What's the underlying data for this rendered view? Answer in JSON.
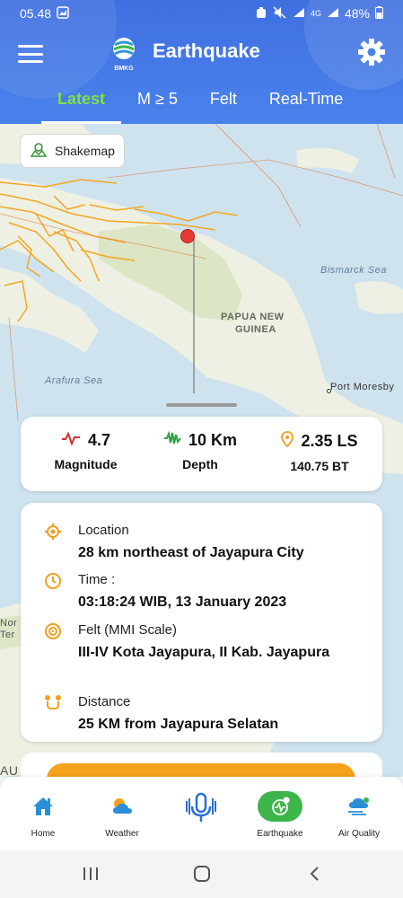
{
  "status": {
    "time": "05.48",
    "network": "4G",
    "battery": "48%"
  },
  "app": {
    "title": "Earthquake",
    "logo_text": "BMKG"
  },
  "tabs": [
    {
      "label": "Latest",
      "active": true
    },
    {
      "label": "M ≥ 5",
      "active": false
    },
    {
      "label": "Felt",
      "active": false
    },
    {
      "label": "Real-Time",
      "active": false
    }
  ],
  "map": {
    "shakemap_label": "Shakemap",
    "labels": {
      "bismarck": "Bismarck Sea",
      "papua": "PAPUA NEW",
      "guinea": "GUINEA",
      "arafura": "Arafura Sea",
      "moresby": "Port Moresby",
      "nor": "Nor",
      "ter": "Ter",
      "au": "AU"
    }
  },
  "summary": {
    "magnitude_value": "4.7",
    "magnitude_label": "Magnitude",
    "depth_value": "10 Km",
    "depth_label": "Depth",
    "lat_value": "2.35 LS",
    "lon_value": "140.75 BT"
  },
  "detail": {
    "location_label": "Location",
    "location_value": "28 km northeast of Jayapura City",
    "time_label": "Time :",
    "time_value": "03:18:24 WIB, 13 January 2023",
    "felt_label": "Felt (MMI Scale)",
    "felt_value": "III-IV Kota Jayapura, II Kab. Jayapura",
    "distance_label": "Distance",
    "distance_value": "25 KM from Jayapura Selatan"
  },
  "bottom_nav": [
    {
      "label": "Home",
      "icon": "home-icon",
      "active": false
    },
    {
      "label": "Weather",
      "icon": "weather-icon",
      "active": false
    },
    {
      "label": "",
      "icon": "microphone-icon",
      "active": false
    },
    {
      "label": "Earthquake",
      "icon": "earthquake-icon",
      "active": true
    },
    {
      "label": "Air Quality",
      "icon": "air-quality-icon",
      "active": false
    }
  ],
  "colors": {
    "header": "#4a82ec",
    "active_tab": "#7ee04a",
    "accent_green": "#3db54a",
    "orange": "#f6a21d",
    "epicenter": "#e53935"
  }
}
